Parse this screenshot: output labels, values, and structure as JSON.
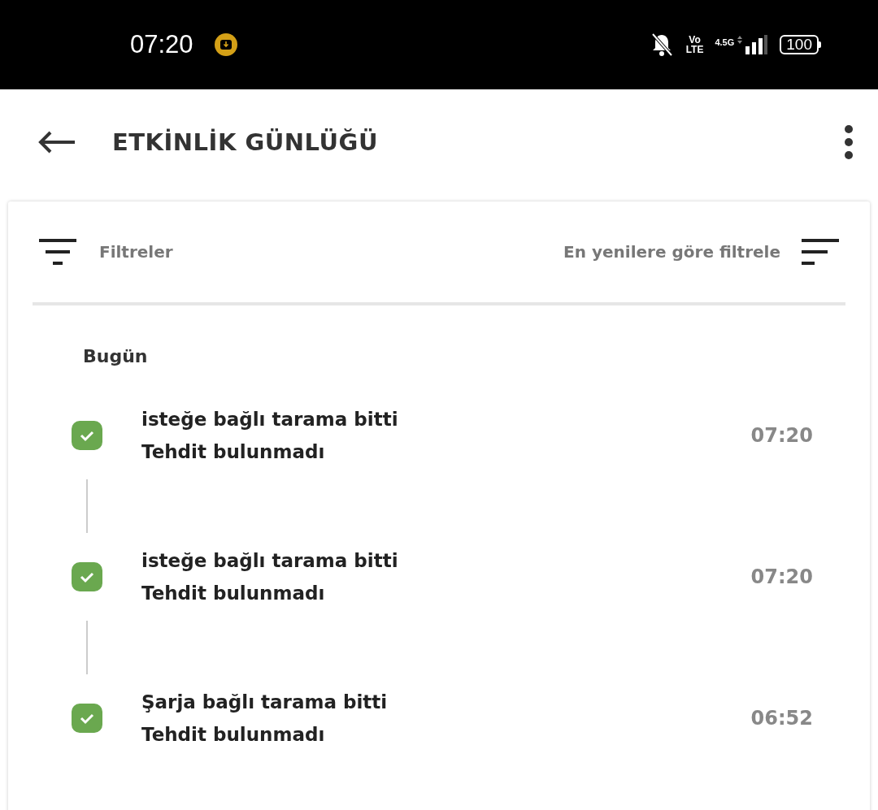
{
  "status_bar": {
    "time": "07:20",
    "volte_top": "Vo",
    "volte_bottom": "LTE",
    "network": "4.5G",
    "battery": "100"
  },
  "app_bar": {
    "title": "ETKİNLİK GÜNLÜĞÜ"
  },
  "filter_bar": {
    "filters_label": "Filtreler",
    "sort_label": "En yenilere göre filtrele"
  },
  "sections": [
    {
      "heading": "Bugün",
      "events": [
        {
          "title": "isteğe bağlı tarama bitti",
          "subtitle": "Tehdit bulunmadı",
          "time": "07:20"
        },
        {
          "title": "isteğe bağlı tarama bitti",
          "subtitle": "Tehdit bulunmadı",
          "time": "07:20"
        },
        {
          "title": "Şarja bağlı tarama bitti",
          "subtitle": "Tehdit bulunmadı",
          "time": "06:52"
        }
      ]
    }
  ]
}
